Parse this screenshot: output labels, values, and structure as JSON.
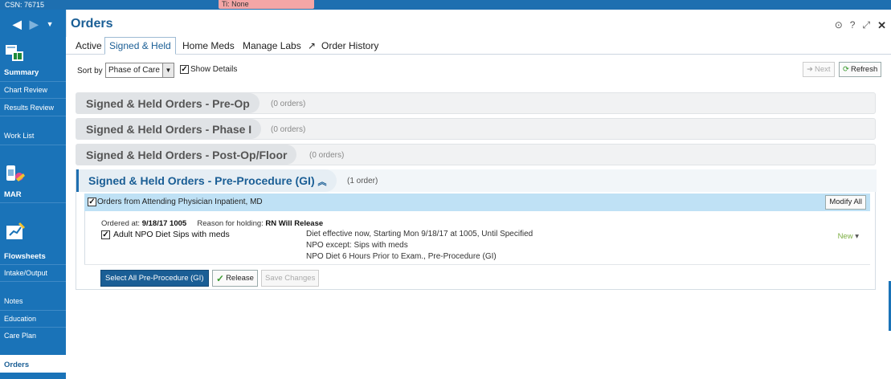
{
  "topbar": {
    "csn": "CSN: 76715",
    "flag": "Ti: None"
  },
  "sidebar": {
    "items": [
      {
        "label": "Summary"
      },
      {
        "label": "Chart Review"
      },
      {
        "label": "Results Review"
      },
      {
        "label": "Work List"
      },
      {
        "label": "MAR"
      },
      {
        "label": "Flowsheets"
      },
      {
        "label": "Intake/Output"
      },
      {
        "label": "Notes"
      },
      {
        "label": "Education"
      },
      {
        "label": "Care Plan"
      },
      {
        "label": "Orders"
      }
    ]
  },
  "header": {
    "title": "Orders"
  },
  "tabs": [
    {
      "label": "Active"
    },
    {
      "label": "Signed & Held"
    },
    {
      "label": "Home Meds"
    },
    {
      "label": "Manage Labs"
    },
    {
      "label": "Order History"
    }
  ],
  "sortbar": {
    "sort_label": "Sort by",
    "sort_value": "Phase of Care",
    "show_details": "Show Details",
    "next_label": "Next",
    "refresh_label": "Refresh"
  },
  "sections": [
    {
      "title": "Signed & Held Orders - Pre-Op",
      "count": "(0 orders)"
    },
    {
      "title": "Signed & Held Orders - Phase I",
      "count": "(0 orders)"
    },
    {
      "title": "Signed & Held Orders - Post-Op/Floor",
      "count": "(0 orders)"
    }
  ],
  "open_section": {
    "title": "Signed & Held Orders - Pre-Procedure (GI)",
    "count": "(1 order)",
    "group": "Orders from Attending Physician Inpatient, MD",
    "modify_all": "Modify All",
    "order": {
      "ordered_at_label": "Ordered at:",
      "ordered_at": "9/18/17  1005",
      "reason_label": "Reason for holding:",
      "reason": "RN Will Release",
      "name": "Adult NPO Diet Sips with meds",
      "detail1": "Diet effective now, Starting Mon 9/18/17 at 1005, Until Specified",
      "detail2": "NPO except: Sips with meds",
      "detail3": "NPO Diet 6 Hours Prior to Exam., Pre-Procedure (GI)",
      "status": "New"
    },
    "select_all": "Select All Pre-Procedure (GI)",
    "release": "Release",
    "save_changes": "Save Changes"
  },
  "icons": [
    "summary-icon",
    "mar-icon",
    "flowsheets-icon",
    "more-icon",
    "help-icon",
    "expand-icon",
    "close-icon"
  ]
}
